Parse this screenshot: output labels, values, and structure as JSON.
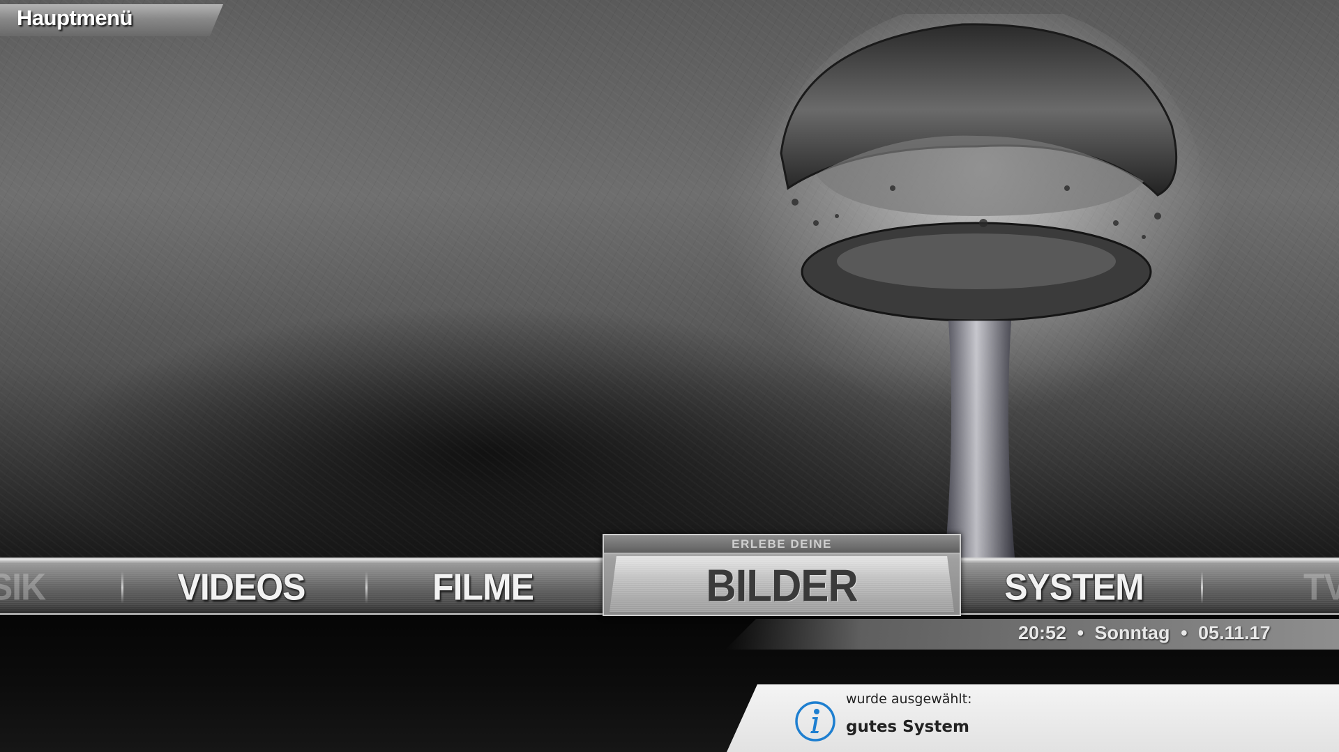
{
  "header": {
    "title": "Hauptmenü"
  },
  "menu": {
    "items": [
      {
        "label": "SIK",
        "faded": true
      },
      {
        "label": "VIDEOS",
        "faded": false
      },
      {
        "label": "FILME",
        "faded": false
      },
      {
        "label": "BILDER",
        "faded": false,
        "selected": true
      },
      {
        "label": "SYSTEM",
        "faded": false
      },
      {
        "label": "TV",
        "faded": true
      }
    ],
    "selected": {
      "subtitle": "ERLEBE DEINE",
      "label": "BILDER"
    }
  },
  "status": {
    "time": "20:52",
    "day": "Sonntag",
    "date": "05.11.17",
    "separator": "•"
  },
  "notification": {
    "icon": "info-icon",
    "caption": "wurde ausgewählt:",
    "message": "gutes System",
    "accent_color": "#1e7fd0"
  },
  "colors": {
    "menu_text": "#f2f2f2",
    "selected_text": "#3a3a3a"
  }
}
